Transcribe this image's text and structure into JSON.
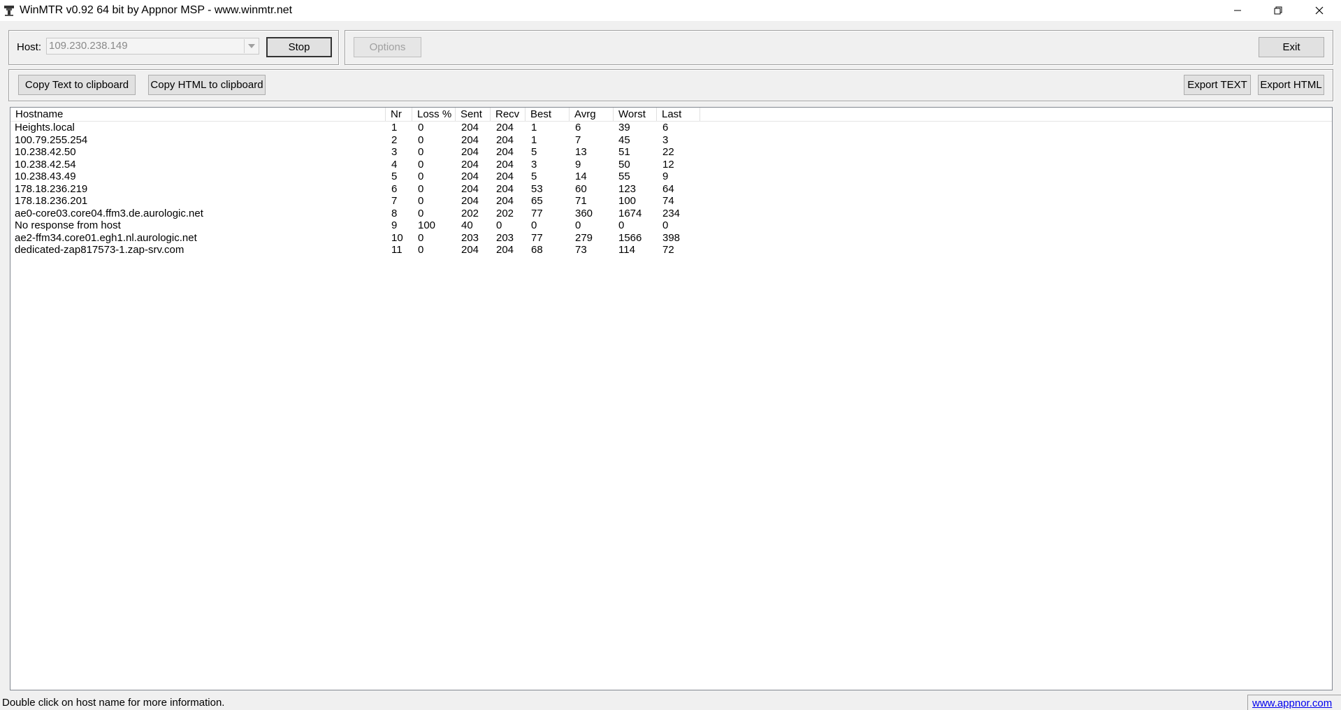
{
  "window": {
    "title": "WinMTR v0.92 64 bit by Appnor MSP - www.winmtr.net"
  },
  "controls": {
    "host_label": "Host:",
    "host_value": "109.230.238.149",
    "stop_label": "Stop",
    "options_label": "Options",
    "exit_label": "Exit",
    "copy_text_label": "Copy Text to clipboard",
    "copy_html_label": "Copy HTML to clipboard",
    "export_text_label": "Export TEXT",
    "export_html_label": "Export HTML"
  },
  "table": {
    "columns": [
      "Hostname",
      "Nr",
      "Loss %",
      "Sent",
      "Recv",
      "Best",
      "Avrg",
      "Worst",
      "Last"
    ],
    "rows": [
      [
        "Heights.local",
        "1",
        "0",
        "204",
        "204",
        "1",
        "6",
        "39",
        "6"
      ],
      [
        "100.79.255.254",
        "2",
        "0",
        "204",
        "204",
        "1",
        "7",
        "45",
        "3"
      ],
      [
        "10.238.42.50",
        "3",
        "0",
        "204",
        "204",
        "5",
        "13",
        "51",
        "22"
      ],
      [
        "10.238.42.54",
        "4",
        "0",
        "204",
        "204",
        "3",
        "9",
        "50",
        "12"
      ],
      [
        "10.238.43.49",
        "5",
        "0",
        "204",
        "204",
        "5",
        "14",
        "55",
        "9"
      ],
      [
        "178.18.236.219",
        "6",
        "0",
        "204",
        "204",
        "53",
        "60",
        "123",
        "64"
      ],
      [
        "178.18.236.201",
        "7",
        "0",
        "204",
        "204",
        "65",
        "71",
        "100",
        "74"
      ],
      [
        "ae0-core03.core04.ffm3.de.aurologic.net",
        "8",
        "0",
        "202",
        "202",
        "77",
        "360",
        "1674",
        "234"
      ],
      [
        "No response from host",
        "9",
        "100",
        "40",
        "0",
        "0",
        "0",
        "0",
        "0"
      ],
      [
        "ae2-ffm34.core01.egh1.nl.aurologic.net",
        "10",
        "0",
        "203",
        "203",
        "77",
        "279",
        "1566",
        "398"
      ],
      [
        "dedicated-zap817573-1.zap-srv.com",
        "11",
        "0",
        "204",
        "204",
        "68",
        "73",
        "114",
        "72"
      ]
    ]
  },
  "status": {
    "message": "Double click on host name for more information.",
    "link": "www.appnor.com"
  }
}
